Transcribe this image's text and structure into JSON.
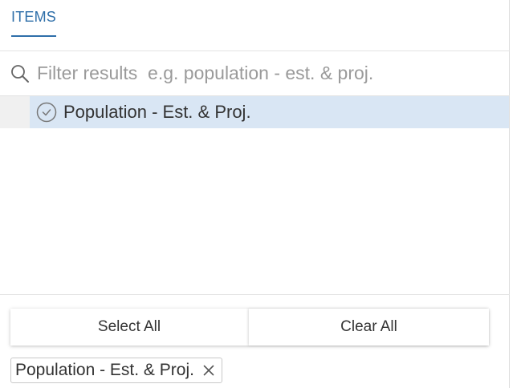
{
  "tabs": {
    "items_label": "ITEMS"
  },
  "search": {
    "value": "",
    "placeholder": "Filter results  e.g. population - est. & proj."
  },
  "results": [
    {
      "label": "Population - Est. & Proj.",
      "selected": true
    }
  ],
  "actions": {
    "select_all_label": "Select All",
    "clear_all_label": "Clear All"
  },
  "selected_chips": [
    {
      "label": "Population - Est. & Proj."
    }
  ],
  "colors": {
    "accent": "#2f6fa9",
    "selected_row": "#d9e6f4",
    "text": "#333333",
    "placeholder": "#9a9a9a"
  },
  "icons": {
    "search": "search-icon",
    "check": "check-circle-icon",
    "remove": "close-icon"
  }
}
